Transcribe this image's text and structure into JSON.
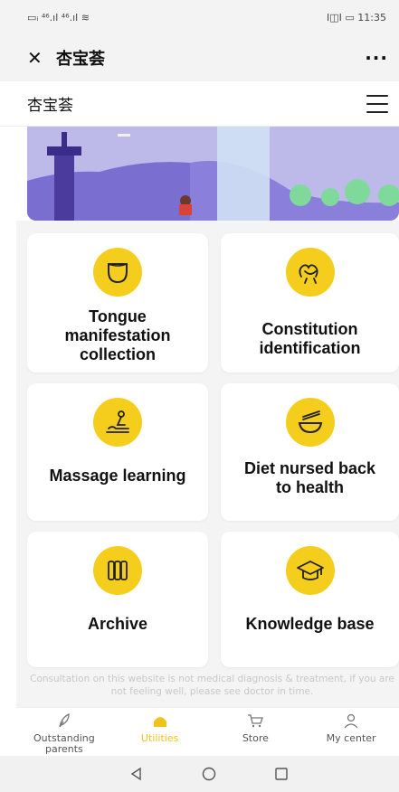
{
  "status_bar": {
    "signal_text": "▭ᵢ ⁴⁶.ıl ⁴⁶.ıl ≋",
    "right_text": "I◫I ▭ 11:35"
  },
  "title_bar": {
    "title": "杏宝荟",
    "more": "···"
  },
  "page_header": {
    "title": "杏宝荟"
  },
  "cards": [
    {
      "label": "Tongue\nmanifestation\ncollection",
      "icon": "tongue-icon"
    },
    {
      "label": "Constitution\nidentification",
      "icon": "constitution-icon"
    },
    {
      "label": "Massage learning",
      "icon": "massage-icon"
    },
    {
      "label": "Diet nursed back\nto health",
      "icon": "diet-bowl-icon"
    },
    {
      "label": "Archive",
      "icon": "archive-icon"
    },
    {
      "label": "Knowledge base",
      "icon": "graduation-cap-icon"
    }
  ],
  "disclaimer": "Consultation on this website is not medical diagnosis & treatment, if you are not feeling well, please see doctor in time.",
  "tabs": [
    {
      "label": "Outstanding\nparents",
      "icon": "feather-icon",
      "active": false
    },
    {
      "label": "Utilities",
      "icon": "utilities-icon",
      "active": true
    },
    {
      "label": "Store",
      "icon": "cart-icon",
      "active": false
    },
    {
      "label": "My center",
      "icon": "person-icon",
      "active": false
    }
  ],
  "colors": {
    "accent": "#f5cd1c",
    "active_tab": "#f0c21a",
    "banner": "#b9b6e7"
  }
}
